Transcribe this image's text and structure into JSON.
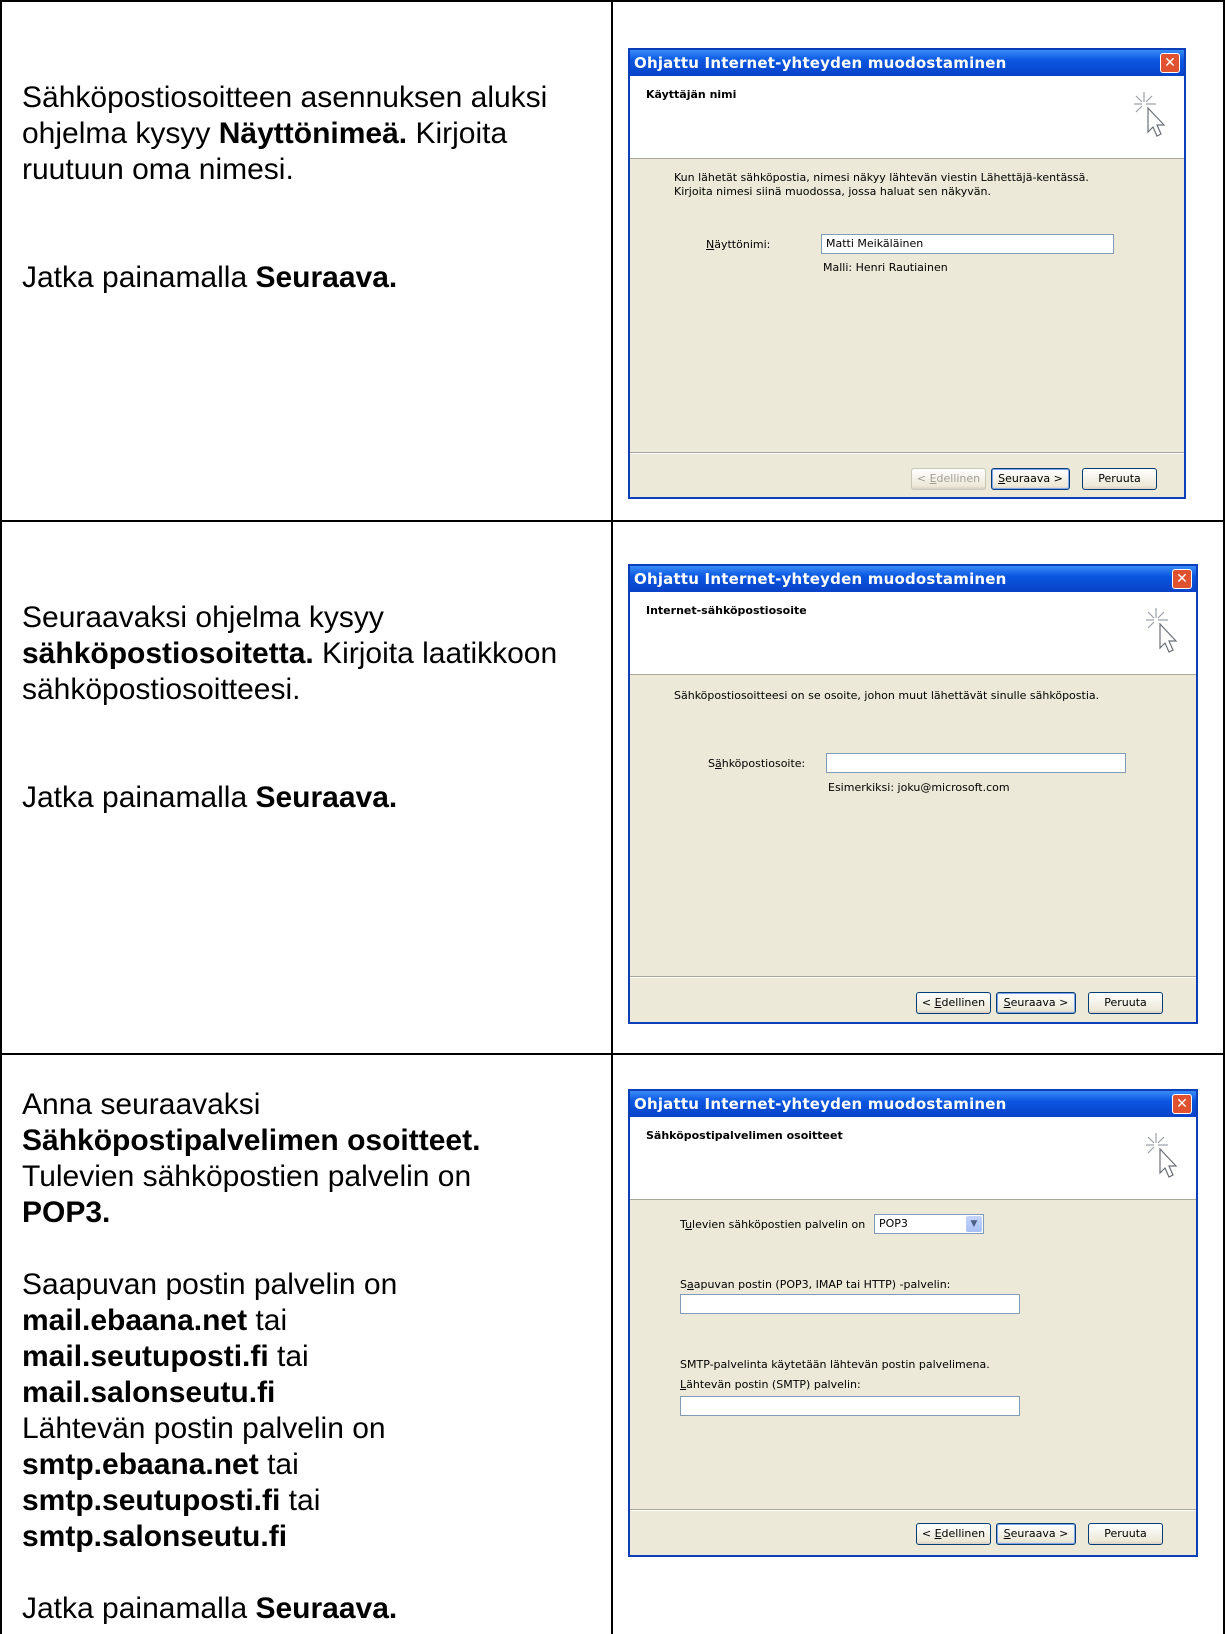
{
  "rows": [
    {
      "instruction": {
        "p1_pre": "Sähköpostiosoitteen asennuksen aluksi ohjelma kysyy ",
        "p1_bold": "Näyttönimeä.",
        "p1_post": " Kirjoita ruutuun oma nimesi.",
        "p2_pre": "Jatka painamalla ",
        "p2_bold": "Seuraava."
      },
      "dialog": {
        "title": "Ohjattu Internet-yhteyden muodostaminen",
        "header": "Käyttäjän nimi",
        "description": "Kun lähetät sähköpostia, nimesi näkyy lähtevän viestin Lähettäjä-kentässä. Kirjoita nimesi siinä muodossa, jossa haluat sen näkyvän.",
        "field_label_u": "N",
        "field_label_rest": "äyttönimi:",
        "field_value": "Matti Meikäläinen",
        "hint": "Malli: Henri Rautiainen",
        "back_lt": "< ",
        "back_u": "E",
        "back_rest": "dellinen",
        "next_u": "S",
        "next_rest": "euraava >",
        "cancel": "Peruuta"
      }
    },
    {
      "instruction": {
        "p1_pre": "Seuraavaksi ohjelma kysyy ",
        "p1_bold": "sähköpostiosoitetta.",
        "p1_post": " Kirjoita laatikkoon sähköpostiosoitteesi.",
        "p2_pre": "Jatka painamalla ",
        "p2_bold": "Seuraava."
      },
      "dialog": {
        "title": "Ohjattu Internet-yhteyden muodostaminen",
        "header": "Internet-sähköpostiosoite",
        "description": "Sähköpostiosoitteesi on se osoite, johon muut lähettävät sinulle sähköpostia.",
        "field_label_pre": "S",
        "field_label_u": "ä",
        "field_label_rest": "hköpostiosoite:",
        "field_value": "",
        "hint": "Esimerkiksi: joku@microsoft.com",
        "back_lt": "< ",
        "back_u": "E",
        "back_rest": "dellinen",
        "next_u": "S",
        "next_rest": "euraava >",
        "cancel": "Peruuta"
      }
    },
    {
      "instruction": {
        "l1": "Anna seuraavaksi",
        "l2_bold": "Sähköpostipalvelimen osoitteet.",
        "l3": "Tulevien sähköpostien palvelin on",
        "l4_bold": "POP3.",
        "l5": "Saapuvan postin palvelin on",
        "l6_bold": "mail.ebaana.net",
        "l6_post": " tai",
        "l7_bold": "mail.seutuposti.fi",
        "l7_post": " tai",
        "l8_bold": "mail.salonseutu.fi",
        "l9": "Lähtevän postin palvelin on",
        "l10_bold": "smtp.ebaana.net",
        "l10_post": " tai",
        "l11_bold": "smtp.seutuposti.fi",
        "l11_post": " tai",
        "l12_bold": "smtp.salonseutu.fi",
        "l13_pre": "Jatka painamalla ",
        "l13_bold": "Seuraava."
      },
      "dialog": {
        "title": "Ohjattu Internet-yhteyden muodostaminen",
        "header": "Sähköpostipalvelimen osoitteet",
        "incoming_type_pre": "T",
        "incoming_type_u": "u",
        "incoming_type_rest": "levien sähköpostien palvelin on",
        "incoming_type_value": "POP3",
        "incoming_label_pre": "S",
        "incoming_label_u": "a",
        "incoming_label_rest": "apuvan postin (POP3, IMAP tai HTTP) -palvelin:",
        "smtp_note": "SMTP-palvelinta käytetään lähtevän postin palvelimena.",
        "outgoing_label_u": "L",
        "outgoing_label_rest": "ähtevän postin (SMTP) palvelin:",
        "back_lt": "< ",
        "back_u": "E",
        "back_rest": "dellinen",
        "next_u": "S",
        "next_rest": "euraava >",
        "cancel": "Peruuta"
      }
    }
  ]
}
